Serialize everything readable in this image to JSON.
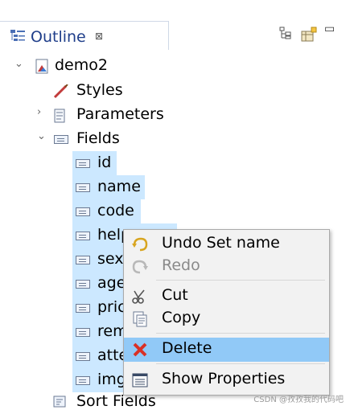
{
  "outline_tab": {
    "title": "Outline",
    "close_symbol": "⊠"
  },
  "toolbar": {
    "icons": [
      "collapse-all-icon",
      "new-item-icon",
      "minimize-icon"
    ],
    "minimize_symbol": "▭"
  },
  "tree": {
    "root": {
      "label": "demo2",
      "expanded": true
    },
    "children": [
      {
        "label": "Styles",
        "icon": "brush-icon"
      },
      {
        "label": "Parameters",
        "icon": "parameters-icon",
        "expanded": false
      },
      {
        "label": "Fields",
        "icon": "fields-icon",
        "expanded": true,
        "items": [
          "id",
          "name",
          "code",
          "help",
          "sex",
          "age",
          "pric",
          "rem",
          "atte",
          "img"
        ]
      },
      {
        "label": "Sort Fields",
        "icon": "sort-fields-icon"
      }
    ],
    "twisty_expanded": "⌄",
    "twisty_collapsed": "›"
  },
  "context_menu": {
    "items": [
      {
        "label": "Undo Set name",
        "icon": "undo-icon",
        "enabled": true
      },
      {
        "label": "Redo",
        "icon": "redo-icon",
        "enabled": false
      },
      {
        "label": "Cut",
        "icon": "cut-icon",
        "enabled": true
      },
      {
        "label": "Copy",
        "icon": "copy-icon",
        "enabled": true
      },
      {
        "label": "Delete",
        "icon": "delete-icon",
        "enabled": true,
        "highlighted": true
      },
      {
        "label": "Show Properties",
        "icon": "properties-icon",
        "enabled": true
      }
    ]
  },
  "colors": {
    "selection": "#cce8ff",
    "menu_highlight": "#91c9f7",
    "menu_bg": "#f2f2f2",
    "tab_title": "#1f3e8a"
  },
  "watermark": "CSDN @孜孜我的代码吧"
}
